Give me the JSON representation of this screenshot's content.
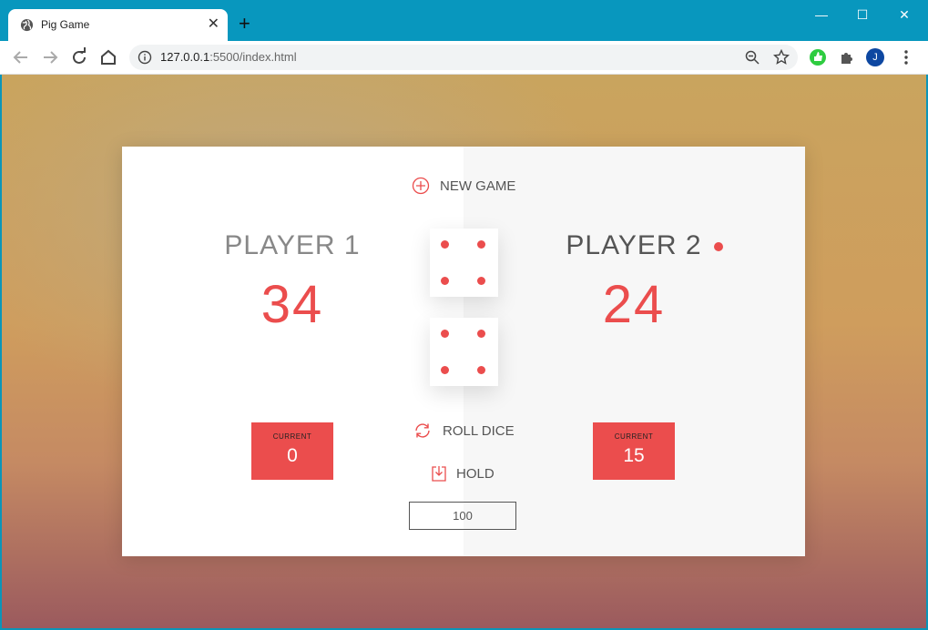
{
  "browser": {
    "tab_title": "Pig Game",
    "tab_close": "✕",
    "new_tab": "+",
    "window_controls": {
      "minimize": "—",
      "maximize": "☐",
      "close": "✕"
    },
    "url_host": "127.0.0.1",
    "url_rest": ":5500/index.html",
    "profile_initial": "J"
  },
  "game": {
    "new_game_label": "NEW GAME",
    "roll_dice_label": "ROLL DICE",
    "hold_label": "HOLD",
    "player1": {
      "name": "PLAYER 1",
      "score": "34",
      "current_label": "CURRENT",
      "current": "0"
    },
    "player2": {
      "name": "PLAYER 2",
      "score": "24",
      "current_label": "CURRENT",
      "current": "15"
    },
    "active_player": 2,
    "dice": [
      4,
      4
    ],
    "winning_score": "100"
  },
  "colors": {
    "accent": "#eb4d4d",
    "chrome": "#0897be"
  }
}
